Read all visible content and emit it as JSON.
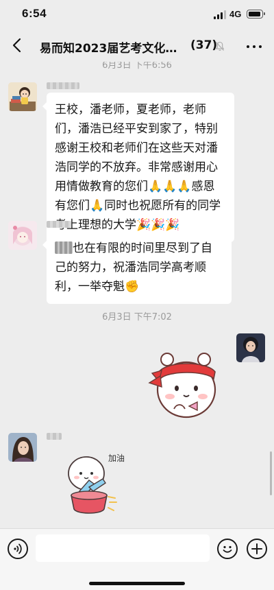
{
  "status_bar": {
    "time": "6:54",
    "network": "4G"
  },
  "nav": {
    "title": "易而知2023届艺考文化…",
    "member_count": "(37)",
    "muted": true
  },
  "timestamps": {
    "top_partial": "6月3日 下午6:56",
    "middle": "6月3日 下午7:02"
  },
  "messages": [
    {
      "side": "left",
      "avatar": "cartoon-girl-avatar",
      "text": "王校，潘老师，夏老师，老师们，潘浩已经平安到家了，特别感谢王校和老师们在这些天对潘浩同学的不放弃。非常感谢用心用情做教育的您们🙏🙏🙏感恩有您们🙏同时也祝愿所有的同学考上理想的大学🎉🎉🎉"
    },
    {
      "side": "left",
      "avatar": "anime-girl-avatar",
      "text_after_blur": "也在有限的时间里尽到了自己的努力，祝潘浩同学高考顺利，一举夺魁✊"
    },
    {
      "side": "right",
      "avatar": "girl-photo-avatar",
      "sticker": "cartoon-bear-headband-sticker"
    },
    {
      "side": "left",
      "avatar": "woman-photo-avatar",
      "sticker": "jiayou-cheer-sticker",
      "sticker_text": "加油"
    }
  ],
  "input": {
    "placeholder": ""
  },
  "icons": {
    "back": "back-chevron-icon",
    "mute": "bell-slash-icon",
    "more": "more-dots-icon",
    "voice": "voice-icon",
    "emoji": "emoji-icon",
    "plus": "plus-icon"
  }
}
